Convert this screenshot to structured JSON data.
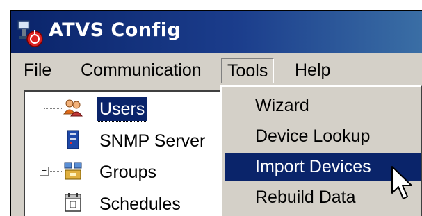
{
  "window": {
    "title": "ATVS Config",
    "icon": "atvs-app-icon"
  },
  "menubar": {
    "items": [
      "File",
      "Communication",
      "Tools",
      "Help"
    ],
    "open_menu": "Tools"
  },
  "tree": {
    "items": [
      {
        "label": "Users",
        "icon": "users-icon",
        "selected": true
      },
      {
        "label": "SNMP Server",
        "icon": "server-icon",
        "selected": false
      },
      {
        "label": "Groups",
        "icon": "groups-icon",
        "selected": false,
        "expandable": true
      },
      {
        "label": "Schedules",
        "icon": "calendar-icon",
        "selected": false
      }
    ]
  },
  "tools_menu": {
    "items": [
      "Wizard",
      "Device Lookup",
      "Import Devices",
      "Rebuild Data"
    ],
    "highlighted": "Import Devices"
  },
  "colors": {
    "face": "#d4d0c8",
    "title_active": "#0a246a",
    "highlight": "#0a246a"
  }
}
